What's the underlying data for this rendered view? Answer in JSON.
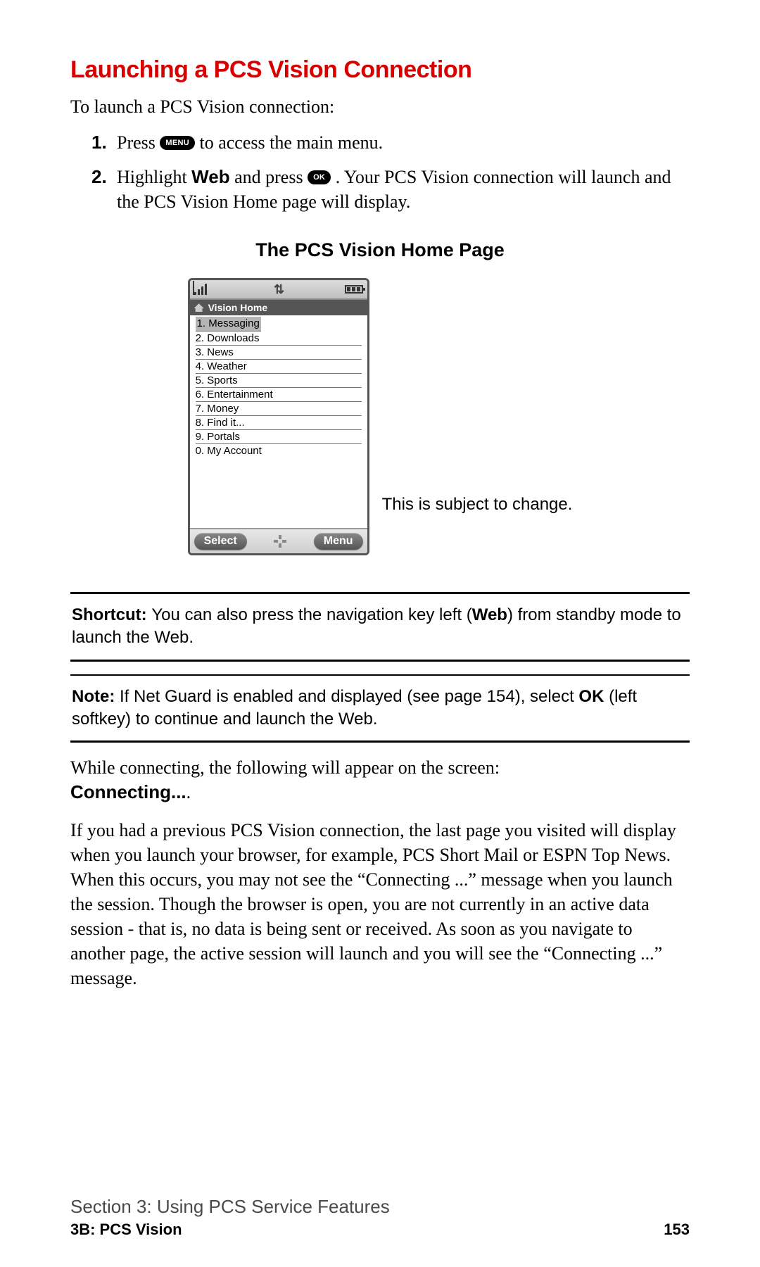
{
  "heading": "Launching a PCS Vision Connection",
  "intro": "To launch a PCS Vision connection:",
  "steps": {
    "n1": "1.",
    "s1a": "Press ",
    "s1_btn": "MENU",
    "s1b": "  to access the main menu.",
    "n2": "2.",
    "s2a": "Highlight ",
    "s2_web": "Web",
    "s2b": " and press  ",
    "s2_btn": "OK",
    "s2c": " . Your PCS Vision connection will launch and the PCS Vision Home page will display."
  },
  "subheading": "The PCS Vision Home Page",
  "phone": {
    "title": "Vision Home",
    "items": [
      "1. Messaging",
      "2. Downloads",
      "3. News",
      "4. Weather",
      "5. Sports",
      "6. Entertainment",
      "7. Money",
      "8. Find it...",
      "9. Portals",
      "0. My Account"
    ],
    "soft_left": "Select",
    "soft_right": "Menu"
  },
  "caption": "This is subject to change.",
  "shortcut": {
    "lead": "Shortcut: ",
    "a": "You can also press the navigation key left (",
    "web": "Web",
    "b": ") from standby mode to launch the Web."
  },
  "note": {
    "lead": "Note: ",
    "a": "If Net Guard is enabled and displayed (see page 154), select ",
    "ok": "OK",
    "b": " (left softkey) to continue and launch the Web."
  },
  "connecting_p": {
    "a": "While connecting, the following will appear on the screen: ",
    "b": "Connecting...",
    "c": "."
  },
  "long_p": "If you had a previous PCS Vision connection, the last page you visited will display when you launch your browser, for example, PCS Short Mail or ESPN Top News. When this occurs, you may not see the “Connecting ...” message when you launch the session. Though the browser is open, you are not currently in an active data session - that is, no data is being sent or received. As soon as you navigate to another page, the active session will launch and you will see the “Connecting ...” message.",
  "footer": {
    "section": "Section 3: Using PCS Service Features",
    "sub": "3B: PCS Vision",
    "page": "153"
  }
}
